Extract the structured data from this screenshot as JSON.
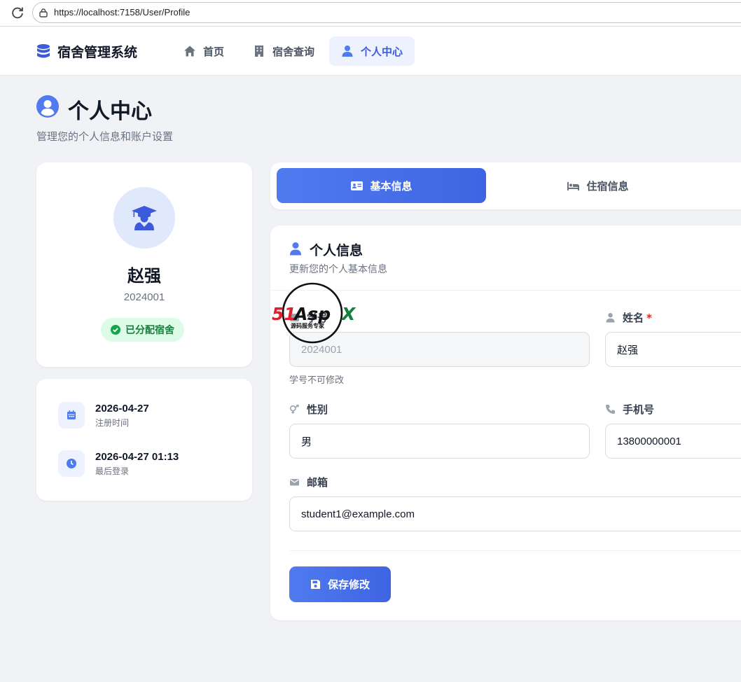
{
  "browser": {
    "url": "https://localhost:7158/User/Profile"
  },
  "navbar": {
    "brand": "宿舍管理系统",
    "items": [
      {
        "label": "首页",
        "icon": "home-icon"
      },
      {
        "label": "宿舍查询",
        "icon": "building-icon"
      },
      {
        "label": "个人中心",
        "icon": "user-icon",
        "active": true
      }
    ]
  },
  "page": {
    "title": "个人中心",
    "subtitle": "管理您的个人信息和账户设置"
  },
  "profile": {
    "name": "赵强",
    "student_id": "2024001",
    "status": "已分配宿舍"
  },
  "times": [
    {
      "value": "2026-04-27",
      "label": "注册时间",
      "icon": "calendar-icon"
    },
    {
      "value": "2026-04-27 01:13",
      "label": "最后登录",
      "icon": "clock-icon"
    }
  ],
  "tabs": [
    {
      "label": "基本信息",
      "icon": "id-card-icon",
      "active": true
    },
    {
      "label": "住宿信息",
      "icon": "bed-icon"
    }
  ],
  "form": {
    "title": "个人信息",
    "description": "更新您的个人基本信息",
    "student_id_label": "学号",
    "student_id_value": "2024001",
    "student_id_help": "学号不可修改",
    "name_label": "姓名",
    "name_required": "*",
    "name_value": "赵强",
    "gender_label": "性别",
    "gender_value": "男",
    "phone_label": "手机号",
    "phone_value": "13800000001",
    "email_label": "邮箱",
    "email_value": "student1@example.com",
    "save_label": "保存修改"
  },
  "watermark": {
    "logo": "51Aspx",
    "tagline": "源码服务专家"
  },
  "colors": {
    "accent": "#3f64e3",
    "success": "#15803d",
    "background": "#f0f2f5"
  }
}
